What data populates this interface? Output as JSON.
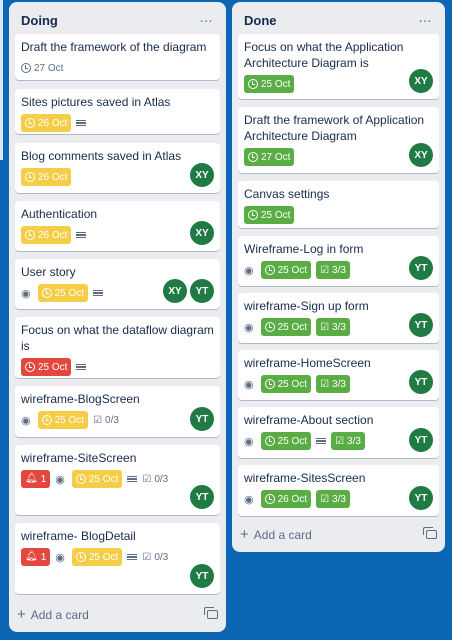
{
  "lists": [
    {
      "title": "Doing",
      "add_card_label": "Add a card",
      "cards": [
        {
          "title": "Draft the framework of the diagram",
          "date": "27 Oct"
        },
        {
          "title": "Sites pictures saved in Atlas",
          "date": "26 Oct"
        },
        {
          "title": "Blog comments saved in Atlas",
          "date": "26 Oct",
          "avatars": [
            "XY"
          ]
        },
        {
          "title": "Authentication",
          "date": "26 Oct",
          "avatars": [
            "XY"
          ]
        },
        {
          "title": "User story",
          "date": "25 Oct",
          "avatars": [
            "XY",
            "YT"
          ]
        },
        {
          "title": "Focus on what the dataflow diagram is",
          "date": "25 Oct"
        },
        {
          "title": "wireframe-BlogScreen",
          "date": "25 Oct",
          "checklist": "0/3",
          "avatars": [
            "YT"
          ]
        },
        {
          "title": "wireframe-SiteScreen",
          "notifications": "1",
          "date": "25 Oct",
          "checklist": "0/3",
          "avatars": [
            "YT"
          ]
        },
        {
          "title": "wireframe- BlogDetail",
          "notifications": "1",
          "date": "25 Oct",
          "checklist": "0/3",
          "avatars": [
            "YT"
          ]
        }
      ]
    },
    {
      "title": "Done",
      "add_card_label": "Add a card",
      "cards": [
        {
          "title": "Focus on what the Application Architecture Diagram is",
          "date": "25 Oct",
          "avatars": [
            "XY"
          ]
        },
        {
          "title": "Draft the framework of Application Architecture Diagram",
          "date": "27 Oct",
          "avatars": [
            "XY"
          ]
        },
        {
          "title": "Canvas settings",
          "date": "25 Oct"
        },
        {
          "title": "Wireframe-Log in form",
          "date": "25 Oct",
          "checklist": "3/3",
          "avatars": [
            "YT"
          ]
        },
        {
          "title": "wireframe-Sign up form",
          "date": "25 Oct",
          "checklist": "3/3",
          "avatars": [
            "YT"
          ]
        },
        {
          "title": "wireframe-HomeScreen",
          "date": "25 Oct",
          "checklist": "3/3",
          "avatars": [
            "YT"
          ]
        },
        {
          "title": "wireframe-About section",
          "date": "25 Oct",
          "checklist": "3/3",
          "avatars": [
            "YT"
          ]
        },
        {
          "title": "wireframe-SitesScreen",
          "date": "26 Oct",
          "checklist": "3/3",
          "avatars": [
            "YT"
          ]
        }
      ]
    }
  ],
  "icons": {
    "menu": "ellipsis-icon",
    "watch": "eye-icon",
    "description": "description-icon",
    "due": "clock-icon",
    "checklist": "checklist-icon",
    "notification": "bell-icon",
    "template": "card-template-icon"
  },
  "colors": {
    "board_bg": "#0c66b4",
    "list_bg": "#ebecf0",
    "due_soon": "#f5cd47",
    "done": "#5aac44",
    "overdue": "#e2483d",
    "avatar": "#1f7a43"
  }
}
